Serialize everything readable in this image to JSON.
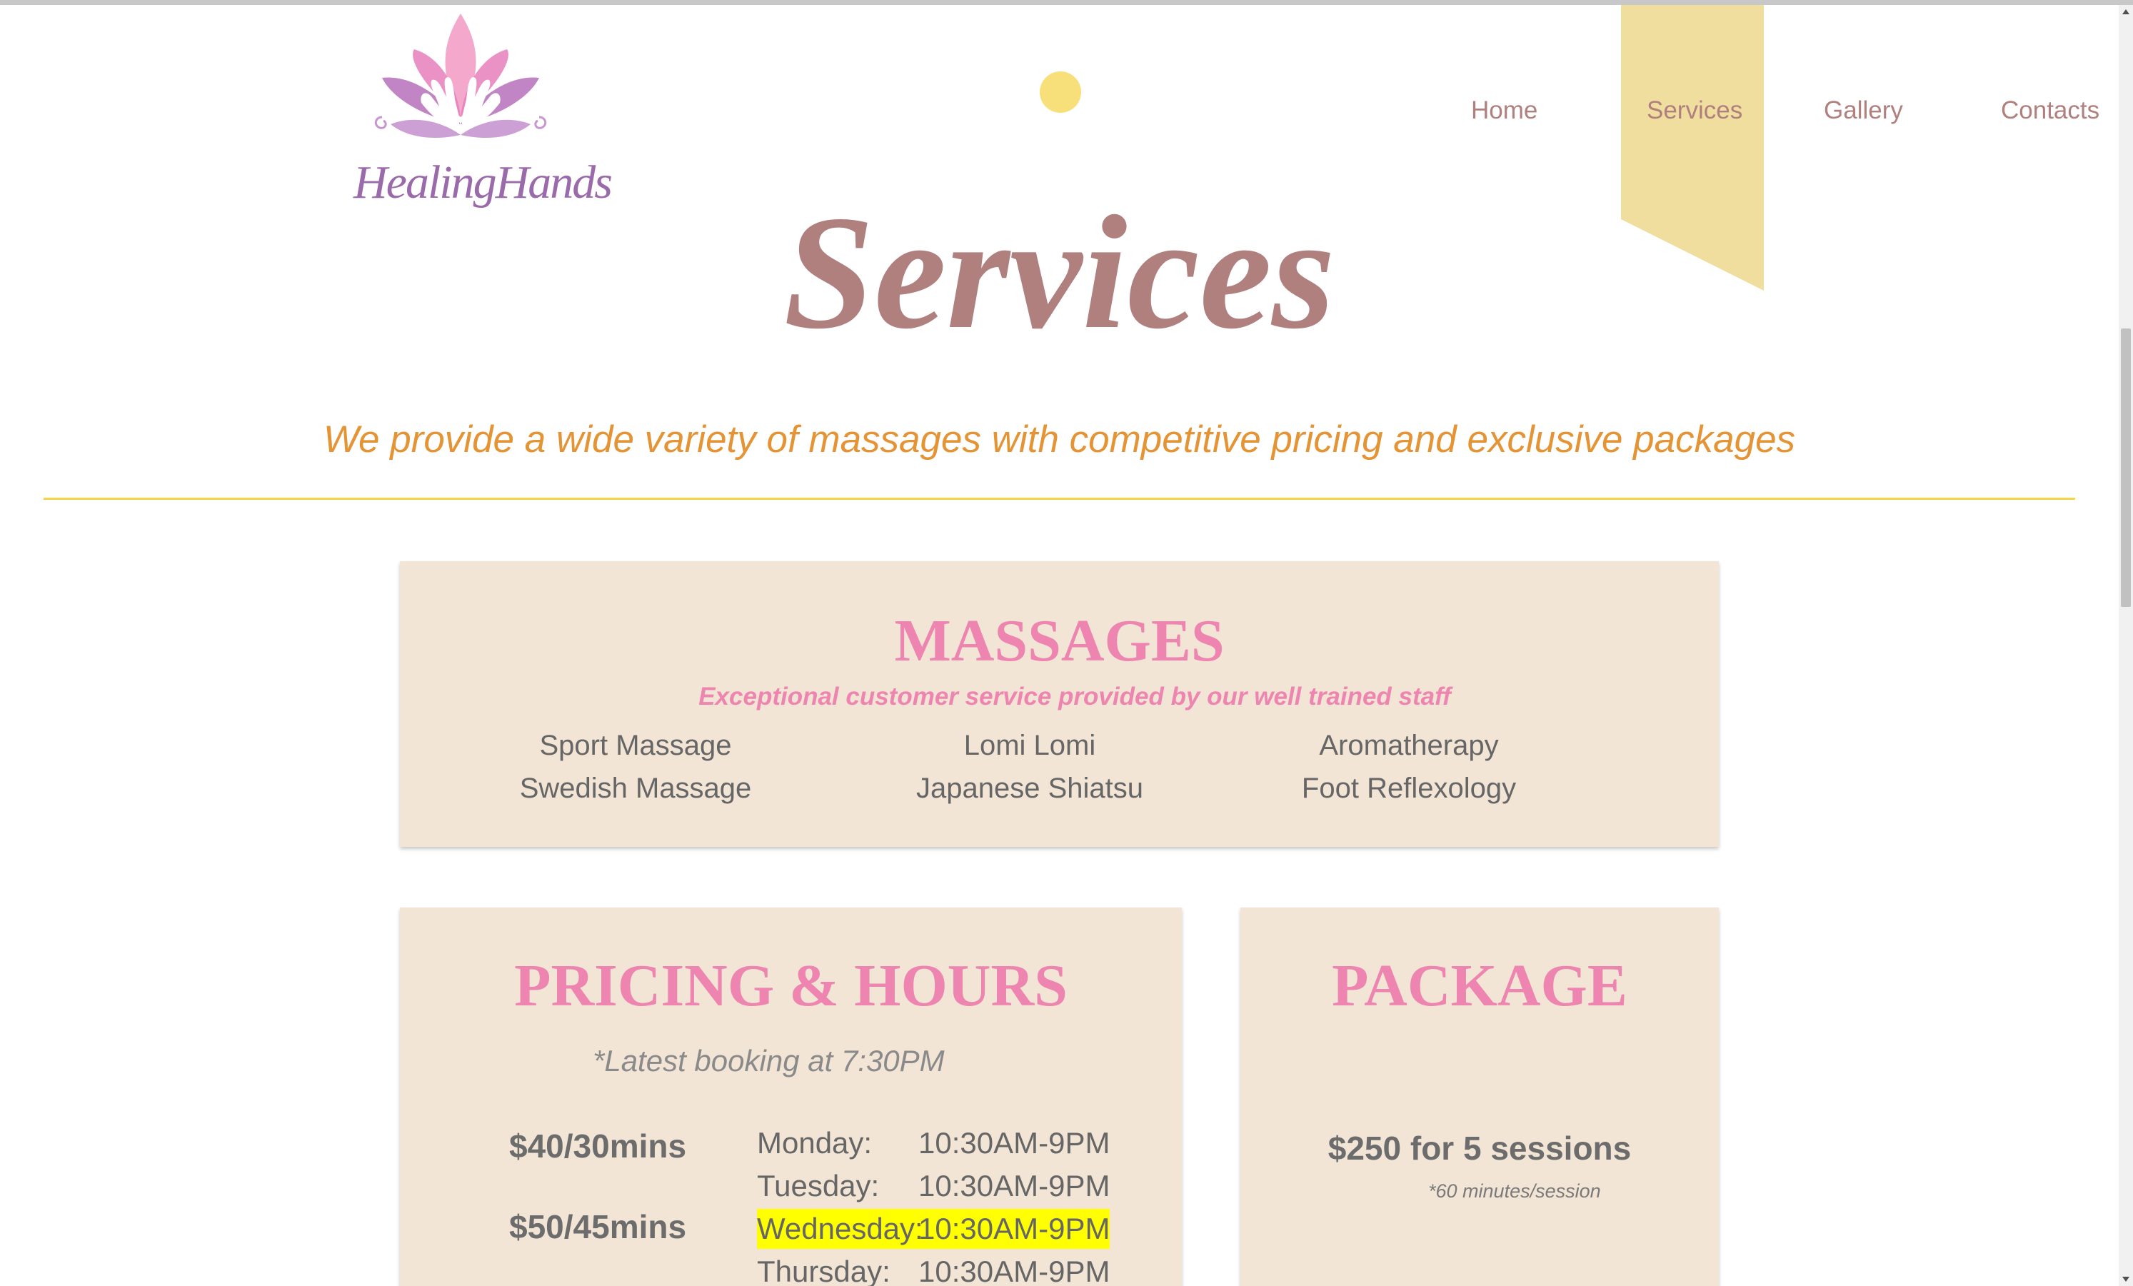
{
  "brand": {
    "logo_text": "HealingHands"
  },
  "nav": {
    "items": [
      {
        "label": "Home",
        "active": false
      },
      {
        "label": "Services",
        "active": true
      },
      {
        "label": "Gallery",
        "active": false
      },
      {
        "label": "Contacts",
        "active": false
      }
    ]
  },
  "page": {
    "title": "Services",
    "tagline": "We provide a wide variety of massages with competitive pricing and exclusive packages"
  },
  "massages": {
    "heading": "MASSAGES",
    "subtitle": "Exceptional customer service provided by our well trained staff",
    "items": [
      "Sport Massage",
      "Lomi Lomi",
      "Aromatherapy",
      "Swedish Massage",
      "Japanese Shiatsu",
      "Foot Reflexology"
    ]
  },
  "pricing": {
    "heading": "PRICING & HOURS",
    "note": "*Latest booking at 7:30PM",
    "prices": [
      "$40/30mins",
      "$50/45mins"
    ],
    "hours": [
      {
        "day": "Monday:",
        "time": "10:30AM-9PM",
        "highlight": false
      },
      {
        "day": "Tuesday:",
        "time": "10:30AM-9PM",
        "highlight": false
      },
      {
        "day": "Wednesday:",
        "time": "10:30AM-9PM",
        "highlight": true
      },
      {
        "day": "Thursday:",
        "time": "10:30AM-9PM",
        "highlight": false
      }
    ]
  },
  "package": {
    "heading": "PACKAGE",
    "price": "$250 for 5 sessions",
    "note": "*60 minutes/session"
  },
  "colors": {
    "accent_pink": "#ed85b0",
    "title_mauve": "#b0807e",
    "tagline_orange": "#e49434",
    "nav_active_ribbon": "#f0de9e",
    "card_bg": "#f2e5d5",
    "divider_yellow": "#f7d54a",
    "highlight_yellow": "#ffff00"
  }
}
